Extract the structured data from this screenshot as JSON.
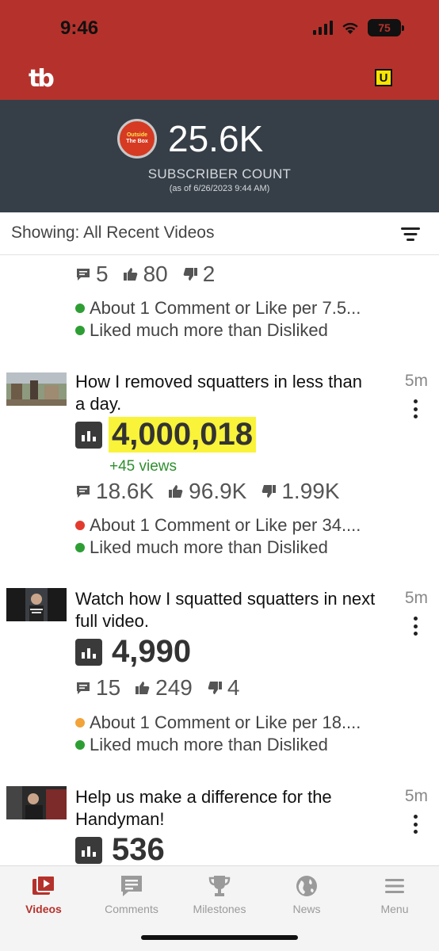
{
  "status_bar": {
    "time": "9:46",
    "battery": "75"
  },
  "app_bar": {
    "logo": "tb",
    "badge": "U"
  },
  "channel": {
    "avatar_text_line1": "Outside",
    "avatar_text_line2": "The Box",
    "subscriber_count": "25.6K",
    "subscriber_label": "SUBSCRIBER COUNT",
    "as_of": "(as of 6/26/2023 9:44 AM)"
  },
  "filter": {
    "showing": "Showing: All Recent Videos"
  },
  "videos": [
    {
      "comments": "5",
      "likes": "80",
      "dislikes": "2",
      "note1": "About 1 Comment or Like per 7.5...",
      "note2": "Liked much more than Disliked",
      "note1_color": "#2e9e34",
      "note2_color": "#2e9e34"
    },
    {
      "title": "How I removed squatters in less than a day.",
      "age": "5m",
      "views": "4,000,018",
      "delta": "+45 views",
      "comments": "18.6K",
      "likes": "96.9K",
      "dislikes": "1.99K",
      "note1": "About 1 Comment or Like per 34....",
      "note2": "Liked much more than Disliked",
      "note1_color": "#e23b2e",
      "note2_color": "#2e9e34"
    },
    {
      "title": "Watch how I squatted squatters in next full video.",
      "age": "5m",
      "views": "4,990",
      "comments": "15",
      "likes": "249",
      "dislikes": "4",
      "note1": "About 1 Comment or Like per 18....",
      "note2": "Liked much more than Disliked",
      "note1_color": "#f2a33a",
      "note2_color": "#2e9e34"
    },
    {
      "title": "Help us make a difference for the Handyman!",
      "age": "5m",
      "views": "536"
    }
  ],
  "tabs": [
    {
      "label": "Videos",
      "icon": "videos-icon",
      "active": true
    },
    {
      "label": "Comments",
      "icon": "comments-icon",
      "active": false
    },
    {
      "label": "Milestones",
      "icon": "trophy-icon",
      "active": false
    },
    {
      "label": "News",
      "icon": "globe-icon",
      "active": false
    },
    {
      "label": "Menu",
      "icon": "hamburger-icon",
      "active": false
    }
  ],
  "colors": {
    "brand": "#b5322c",
    "header": "#363f48",
    "highlight": "#f9f33a"
  }
}
